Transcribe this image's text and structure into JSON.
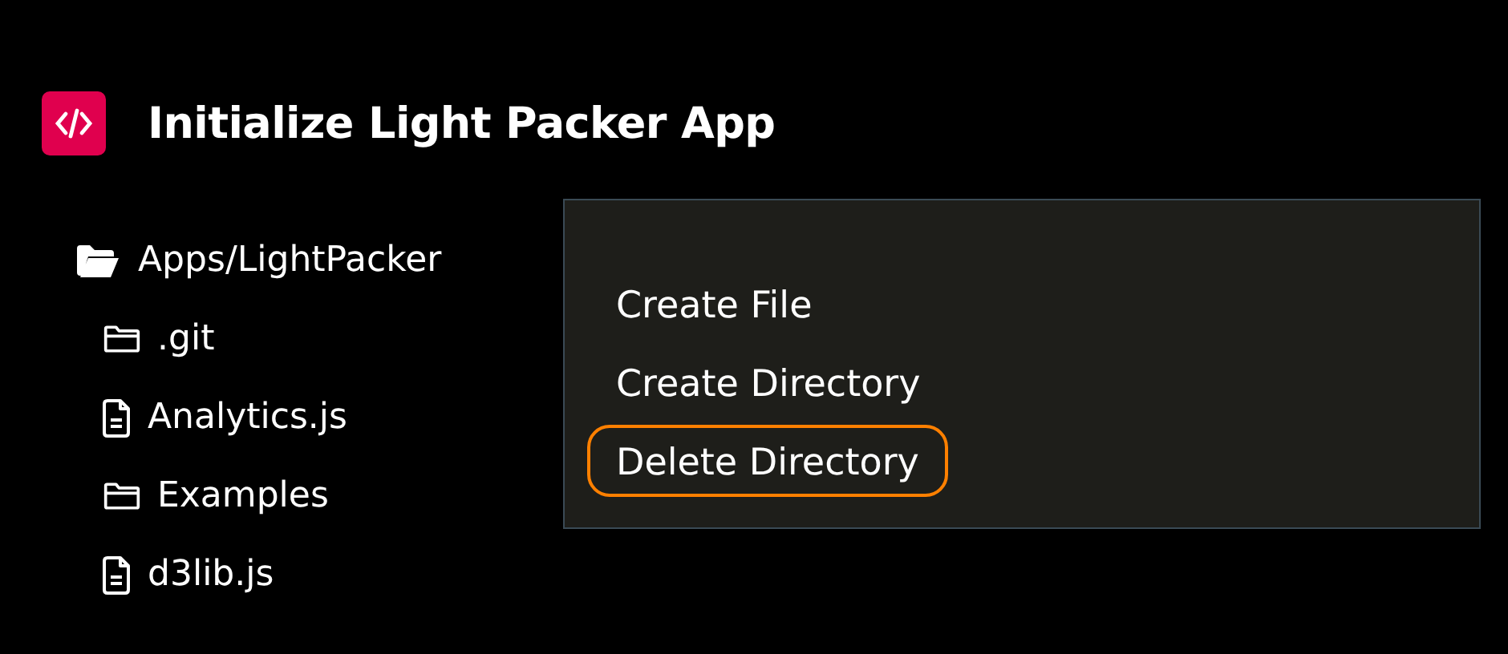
{
  "header": {
    "title": "Initialize Light Packer App"
  },
  "tree": {
    "label": "Apps/LightPacker",
    "kind": "folder",
    "expanded": true,
    "children": [
      {
        "label": ".git",
        "kind": "folder"
      },
      {
        "label": "Analytics.js",
        "kind": "file"
      },
      {
        "label": "Examples",
        "kind": "folder"
      },
      {
        "label": "d3lib.js",
        "kind": "file"
      }
    ]
  },
  "context_menu": {
    "items": [
      {
        "label": "Create File",
        "selected": false
      },
      {
        "label": "Create Directory",
        "selected": false
      },
      {
        "label": "Delete Directory",
        "selected": true
      }
    ]
  }
}
